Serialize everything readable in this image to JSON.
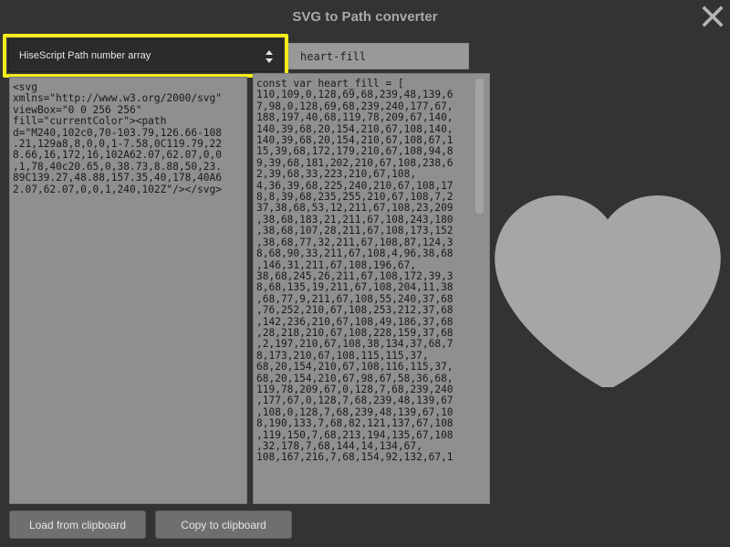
{
  "window": {
    "title": "SVG to Path converter",
    "close_icon": "close-x-icon"
  },
  "format_dropdown": {
    "selected": "HiseScript Path number array",
    "highlight_color": "#f2ec1c",
    "arrow_icon": "up-down-arrows-icon"
  },
  "name_field": {
    "value": "heart-fill"
  },
  "svg_input": {
    "text": "<svg\nxmlns=\"http://www.w3.org/2000/svg\"\nviewBox=\"0 0 256 256\"\nfill=\"currentColor\"><path\nd=\"M240,102c0,70-103.79,126.66-108\n.21,129a8,8,0,0,1-7.58,0C119.79,22\n8.66,16,172,16,102A62.07,62.07,0,0\n,1,78,40c20.65,0,38.73,8.88,50,23.\n89C139.27,48.88,157.35,40,178,40A6\n2.07,62.07,0,0,1,240,102Z\"/></svg>"
  },
  "output": {
    "text": "const var heart_fill = [\n110,109,0,128,69,68,239,48,139,6\n7,98,0,128,69,68,239,240,177,67,\n188,197,40,68,119,78,209,67,140,\n140,39,68,20,154,210,67,108,140,\n140,39,68,20,154,210,67,108,67,1\n15,39,68,172,179,210,67,108,94,8\n9,39,68,181,202,210,67,108,238,6\n2,39,68,33,223,210,67,108,\n4,36,39,68,225,240,210,67,108,17\n8,8,39,68,235,255,210,67,108,7,2\n37,38,68,53,12,211,67,108,23,209\n,38,68,183,21,211,67,108,243,180\n,38,68,107,28,211,67,108,173,152\n,38,68,77,32,211,67,108,87,124,3\n8,68,90,33,211,67,108,4,96,38,68\n,146,31,211,67,108,196,67,\n38,68,245,26,211,67,108,172,39,3\n8,68,135,19,211,67,108,204,11,38\n,68,77,9,211,67,108,55,240,37,68\n,76,252,210,67,108,253,212,37,68\n,142,236,210,67,108,49,186,37,68\n,28,218,210,67,108,228,159,37,68\n,2,197,210,67,108,38,134,37,68,7\n8,173,210,67,108,115,115,37,\n68,20,154,210,67,108,116,115,37,\n68,20,154,210,67,98,67,58,36,68,\n119,78,209,67,0,128,7,68,239,240\n,177,67,0,128,7,68,239,48,139,67\n,108,0,128,7,68,239,48,139,67,10\n8,190,133,7,68,82,121,137,67,108\n,119,150,7,68,213,194,135,67,108\n,32,178,7,68,144,14,134,67,\n108,167,216,7,68,154,92,132,67,1"
  },
  "preview": {
    "icon": "heart-icon",
    "color": "#a6a6a6"
  },
  "buttons": {
    "load": "Load from clipboard",
    "copy": "Copy to clipboard"
  }
}
